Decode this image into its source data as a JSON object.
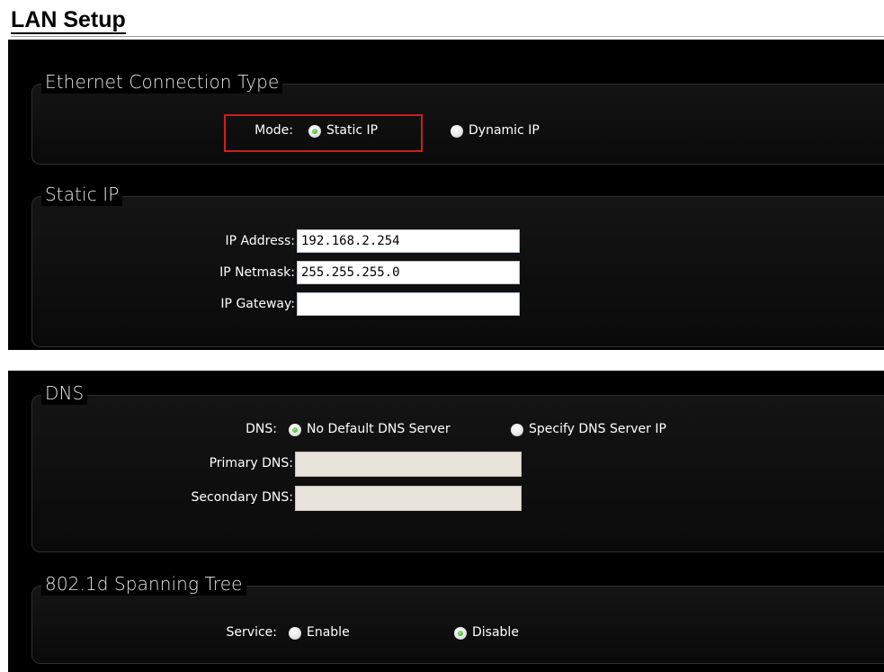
{
  "page": {
    "title": "LAN Setup"
  },
  "ethernet": {
    "legend": "Ethernet Connection Type",
    "mode_label": "Mode:",
    "options": [
      {
        "label": "Static IP",
        "selected": true
      },
      {
        "label": "Dynamic IP",
        "selected": false
      }
    ]
  },
  "static_ip": {
    "legend": "Static IP",
    "fields": [
      {
        "label": "IP Address:",
        "value": "192.168.2.254"
      },
      {
        "label": "IP Netmask:",
        "value": "255.255.255.0"
      },
      {
        "label": "IP Gateway:",
        "value": ""
      }
    ]
  },
  "dns": {
    "legend": "DNS",
    "mode_label": "DNS:",
    "options": [
      {
        "label": "No Default DNS Server",
        "selected": true
      },
      {
        "label": "Specify DNS Server IP",
        "selected": false
      }
    ],
    "primary_label": "Primary DNS:",
    "primary_value": "",
    "secondary_label": "Secondary DNS:",
    "secondary_value": ""
  },
  "stp": {
    "legend": "802.1d Spanning Tree",
    "service_label": "Service:",
    "options": [
      {
        "label": "Enable",
        "selected": false
      },
      {
        "label": "Disable",
        "selected": true
      }
    ]
  },
  "colors": {
    "highlight": "#d11b1b",
    "radio_checked": "#2f9a2a",
    "panel_bg": "#000000"
  }
}
